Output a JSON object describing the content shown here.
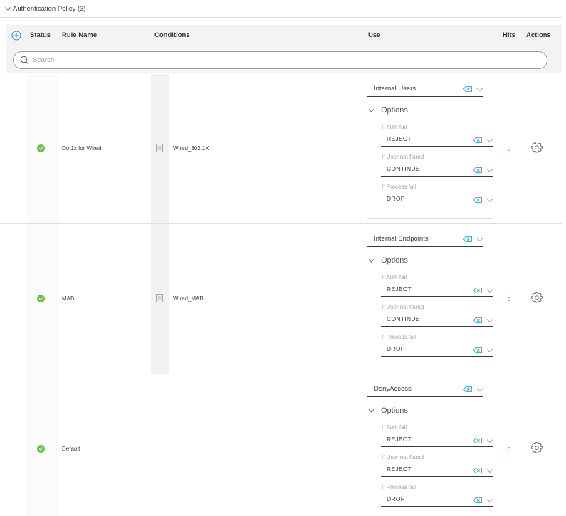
{
  "section": {
    "title": "Authentication Policy (3)"
  },
  "columns": {
    "status": "Status",
    "rule_name": "Rule Name",
    "conditions": "Conditions",
    "use": "Use",
    "hits": "Hits",
    "actions": "Actions"
  },
  "search": {
    "placeholder": "Search"
  },
  "options_label": "Options",
  "field_labels": {
    "auth_fail": "If Auth fail",
    "user_not_found": "If User not found",
    "process_fail": "If Process fail"
  },
  "rows": [
    {
      "rule_name": "Dot1x for Wired",
      "condition": "Wired_802.1X",
      "use": "Internal Users",
      "auth_fail": "REJECT",
      "user_not_found": "CONTINUE",
      "process_fail": "DROP",
      "hits": "0",
      "status": "enabled"
    },
    {
      "rule_name": "MAB",
      "condition": "Wired_MAB",
      "use": "Internal Endpoints",
      "auth_fail": "REJECT",
      "user_not_found": "CONTINUE",
      "process_fail": "DROP",
      "hits": "0",
      "status": "enabled"
    },
    {
      "rule_name": "Default",
      "condition": "",
      "use": "DenyAccess",
      "auth_fail": "REJECT",
      "user_not_found": "REJECT",
      "process_fail": "DROP",
      "hits": "0",
      "status": "enabled"
    }
  ],
  "colors": {
    "status_enabled": "#6cc04a",
    "link_blue": "#049fd9",
    "header_bg": "#f3f3f3",
    "text": "#39393b",
    "muted": "#9e9ea2"
  },
  "icons": {
    "add": "plus-circle-icon",
    "search": "search-icon",
    "status": "check-circle-icon",
    "condition": "document-icon",
    "clear": "clear-icon",
    "dropdown": "chevron-down-icon",
    "actions": "gear-icon"
  }
}
